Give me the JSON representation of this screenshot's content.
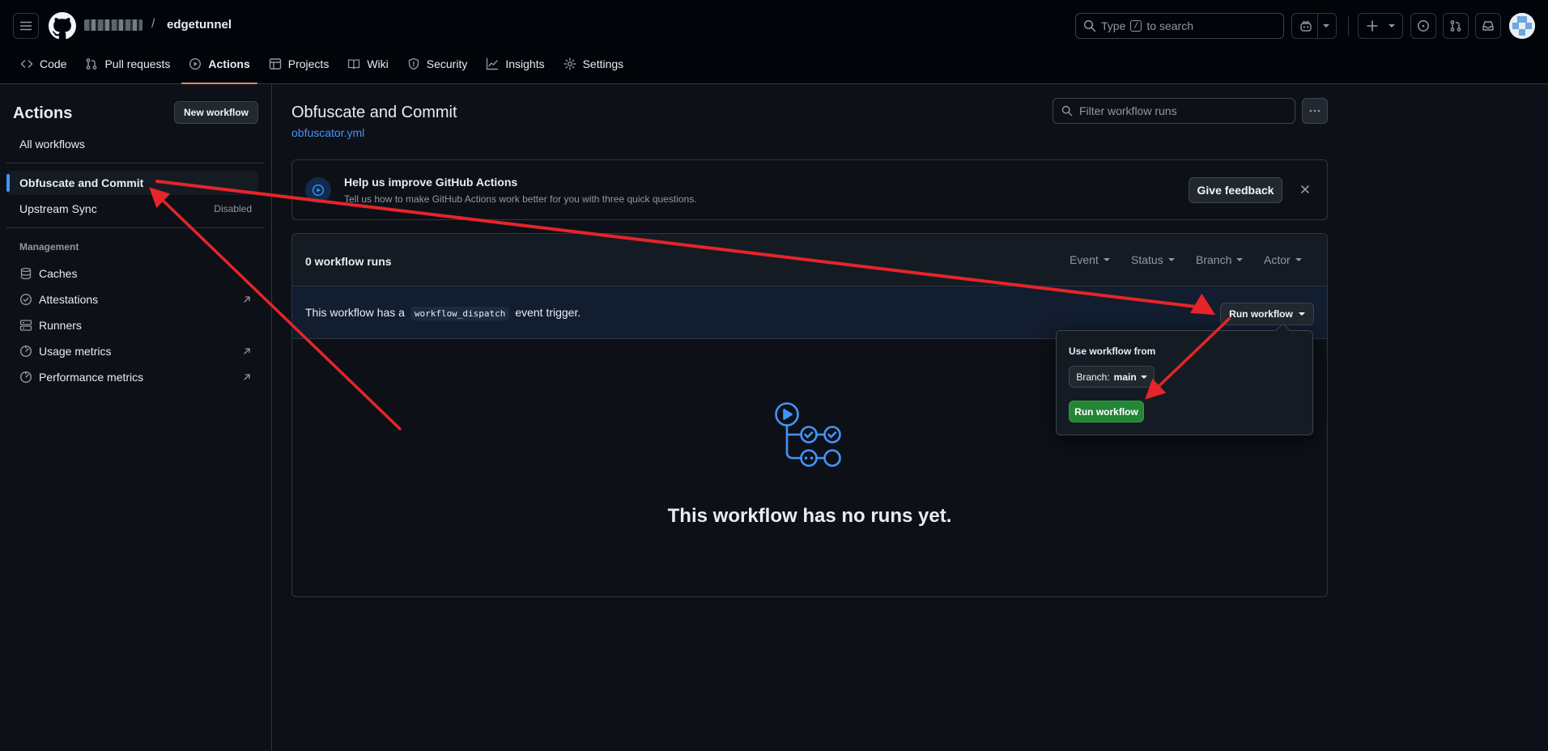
{
  "header": {
    "repo": "edgetunnel",
    "separator": "/",
    "search_prefix": "Type",
    "search_key": "/",
    "search_suffix": "to search"
  },
  "tabs": [
    {
      "label": "Code",
      "icon": "code-icon"
    },
    {
      "label": "Pull requests",
      "icon": "git-pull-request-icon"
    },
    {
      "label": "Actions",
      "icon": "play-icon",
      "active": true
    },
    {
      "label": "Projects",
      "icon": "table-icon"
    },
    {
      "label": "Wiki",
      "icon": "book-icon"
    },
    {
      "label": "Security",
      "icon": "shield-icon"
    },
    {
      "label": "Insights",
      "icon": "graph-icon"
    },
    {
      "label": "Settings",
      "icon": "gear-icon"
    }
  ],
  "sidebar": {
    "title": "Actions",
    "new_workflow": "New workflow",
    "all_workflows": "All workflows",
    "workflows": [
      {
        "label": "Obfuscate and Commit",
        "selected": true
      },
      {
        "label": "Upstream Sync",
        "status": "Disabled"
      }
    ],
    "management_heading": "Management",
    "management": [
      {
        "label": "Caches",
        "icon": "database-icon"
      },
      {
        "label": "Attestations",
        "icon": "verified-icon",
        "external": true
      },
      {
        "label": "Runners",
        "icon": "server-icon"
      },
      {
        "label": "Usage metrics",
        "icon": "meter-icon",
        "external": true
      },
      {
        "label": "Performance metrics",
        "icon": "meter-icon",
        "external": true
      }
    ]
  },
  "main": {
    "title": "Obfuscate and Commit",
    "file": "obfuscator.yml",
    "filter_placeholder": "Filter workflow runs",
    "feedback": {
      "title": "Help us improve GitHub Actions",
      "text": "Tell us how to make GitHub Actions work better for you with three quick questions.",
      "button": "Give feedback"
    },
    "runs": {
      "count": "0 workflow runs",
      "filters": [
        "Event",
        "Status",
        "Branch",
        "Actor"
      ],
      "dispatch_before": "This workflow has a",
      "dispatch_code": "workflow_dispatch",
      "dispatch_after": "event trigger.",
      "run_button": "Run workflow",
      "empty": "This workflow has no runs yet."
    },
    "popover": {
      "label": "Use workflow from",
      "branch_prefix": "Branch:",
      "branch": "main",
      "run": "Run workflow"
    }
  },
  "colors": {
    "background": "#0d1117",
    "accent_blue": "#4493f8",
    "primary_green": "#238636",
    "tab_underline": "#f78166",
    "annotation_red": "#e5252a"
  }
}
